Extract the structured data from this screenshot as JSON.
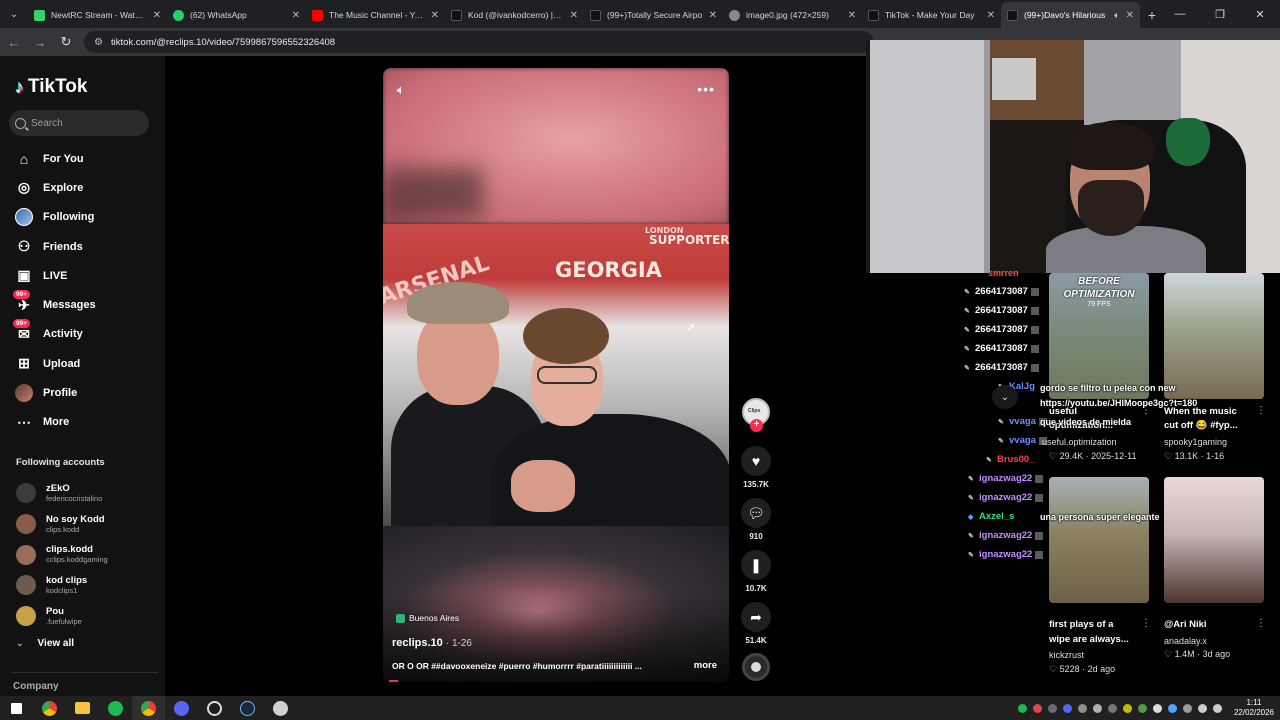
{
  "browser": {
    "tabs": [
      {
        "title": "NewtRC Stream - Watch L",
        "favicon": "#35d16b",
        "active": false
      },
      {
        "title": "(62) WhatsApp",
        "favicon": "#25d366",
        "active": false
      },
      {
        "title": "The Music Channel - YouT",
        "favicon": "#ff0000",
        "active": false
      },
      {
        "title": "Kod (@ivankodcerro) | Tik",
        "favicon": "#111111",
        "active": false
      },
      {
        "title": "(99+)Totally Secure Airpo",
        "favicon": "#111111",
        "active": false
      },
      {
        "title": "image0.jpg (472×259)",
        "favicon": "#888888",
        "active": false
      },
      {
        "title": "TikTok - Make Your Day",
        "favicon": "#111111",
        "active": false
      },
      {
        "title": "(99+)Davo's Hilarious",
        "favicon": "#111111",
        "active": true
      }
    ],
    "url": "tiktok.com/@reclips.10/video/7599867596552326408"
  },
  "sidebar": {
    "logo": "TikTok",
    "search_placeholder": "Search",
    "nav": [
      {
        "label": "For You",
        "icon": "home-icon"
      },
      {
        "label": "Explore",
        "icon": "compass-icon"
      },
      {
        "label": "Following",
        "icon": "following-avatar"
      },
      {
        "label": "Friends",
        "icon": "friends-icon"
      },
      {
        "label": "LIVE",
        "icon": "live-icon"
      },
      {
        "label": "Messages",
        "icon": "messages-icon",
        "badge": "99+"
      },
      {
        "label": "Activity",
        "icon": "activity-icon",
        "badge": "99+"
      },
      {
        "label": "Upload",
        "icon": "upload-icon"
      },
      {
        "label": "Profile",
        "icon": "profile-avatar"
      },
      {
        "label": "More",
        "icon": "more-icon"
      }
    ],
    "following_title": "Following accounts",
    "following": [
      {
        "name": "zEkO",
        "user": "federicocristalino",
        "color": "#3b3b3b"
      },
      {
        "name": "No soy Kodd",
        "user": "clips.kodd",
        "color": "#8a5a4a"
      },
      {
        "name": "clips.kodd",
        "user": "cclips.koddgaming",
        "color": "#9a6b58"
      },
      {
        "name": "kod clips",
        "user": "kodclips1",
        "color": "#6d5a50"
      },
      {
        "name": "Pou",
        "user": ".fuefulwipe",
        "color": "#c9a04a"
      }
    ],
    "view_all": "View all",
    "company": "Company"
  },
  "video": {
    "location": "Buenos Aires",
    "author": "reclips.10",
    "date": "1-26",
    "caption": "OR O OR ##davooxeneize #puerro #humorrrr #paratiiiiiiiiiiiii ...",
    "more": "more",
    "banners": [
      "ARSENAL",
      "GEORGIA",
      "SUPPORTERS",
      "LONDON"
    ]
  },
  "actions": {
    "likes": "135.7K",
    "comments": "910",
    "saves": "10.7K",
    "shares": "51.4K"
  },
  "chat": {
    "users": [
      {
        "name": "smrren",
        "color": "#ff4d4d"
      },
      {
        "name": "2664173087",
        "color": "#ffffff"
      },
      {
        "name": "2664173087",
        "color": "#ffffff"
      },
      {
        "name": "2664173087",
        "color": "#ffffff"
      },
      {
        "name": "2664173087",
        "color": "#ffffff"
      },
      {
        "name": "2664173087",
        "color": "#ffffff"
      },
      {
        "name": "KalJg",
        "color": "#6f8cff"
      },
      {
        "name": "vvaga",
        "color": "#6f8cff"
      },
      {
        "name": "vvaga",
        "color": "#6f8cff"
      },
      {
        "name": "Brus00_",
        "color": "#ff3b4b"
      },
      {
        "name": "ignazwag22",
        "color": "#c48bff"
      },
      {
        "name": "ignazwag22",
        "color": "#c48bff"
      },
      {
        "name": "Axzel_s",
        "color": "#32e07a"
      },
      {
        "name": "ignazwag22",
        "color": "#c48bff"
      },
      {
        "name": "ignazwag22",
        "color": "#c48bff"
      }
    ],
    "messages": [
      "gordo se filtro tu pelea con new",
      "https://youtu.be/JHIMoope3gc?t=180",
      "que videos de mielda",
      "una persona super elegante"
    ]
  },
  "tiles": [
    {
      "thumb_text": "BEFORE OPTIMIZATION",
      "thumb_sub": "79 FPS",
      "title1": "useful",
      "title2": "optimization...",
      "user": "useful.optimization",
      "likes": "29.4K",
      "date": "2025-12-11"
    },
    {
      "thumb_text": "",
      "thumb_sub": "",
      "title1": "When the music",
      "title2": "cut off 😂 #fyp...",
      "user": "spooky1gaming",
      "likes": "13.1K",
      "date": "1-16"
    },
    {
      "thumb_text": "",
      "thumb_sub": "",
      "title1": "first plays of a",
      "title2": "wipe are always...",
      "user": "kickzrust",
      "likes": "5228",
      "date": "2d ago"
    },
    {
      "thumb_text": "",
      "thumb_sub": "",
      "title1": "@Ari Niki",
      "title2": "",
      "user": "anadalay.x",
      "likes": "1.4M",
      "date": "3d ago"
    }
  ],
  "taskbar": {
    "time": "1:11",
    "date": "22/02/2026"
  }
}
